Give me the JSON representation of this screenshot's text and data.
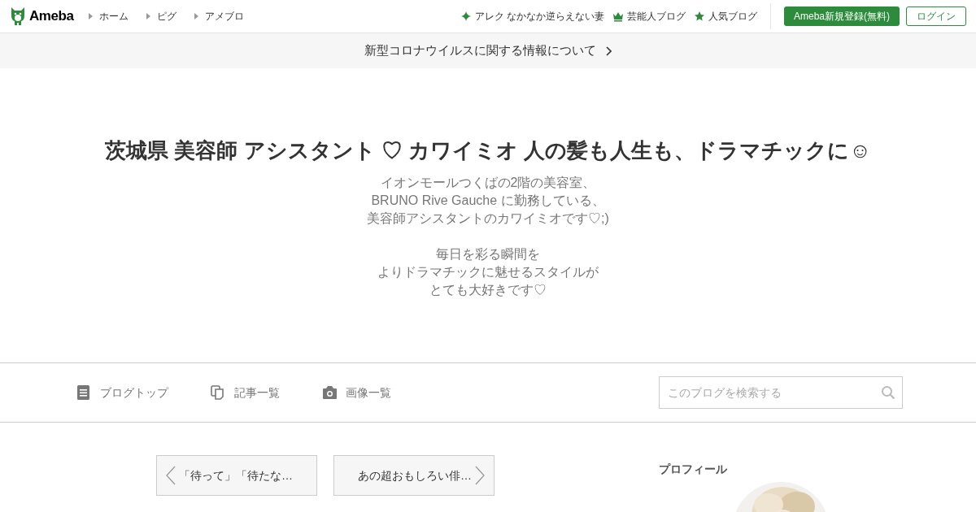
{
  "header": {
    "logo": "Ameba",
    "nav": [
      {
        "label": "ホーム"
      },
      {
        "label": "ピグ"
      },
      {
        "label": "アメブロ"
      }
    ],
    "links": [
      {
        "kind": "sparkle",
        "label": "アレク なかなか逆らえない妻"
      },
      {
        "kind": "crown",
        "label": "芸能人ブログ"
      },
      {
        "kind": "star",
        "label": "人気ブログ"
      }
    ],
    "register_button": "Ameba新規登録(無料)",
    "login_button": "ログイン"
  },
  "notice": {
    "text": "新型コロナウイルスに関する情報について"
  },
  "blog": {
    "title": "茨城県 美容師 アシスタント ♡ カワイミオ 人の髪も人生も、ドラマチックに☺",
    "description": [
      [
        "イオンモールつくばの2階の美容室、",
        "BRUNO Rive Gauche に勤務している、",
        "美容師アシスタントのカワイミオです♡;)"
      ],
      [
        "毎日を彩る瞬間を",
        "よりドラマチックに魅せるスタイルが",
        "とても大好きです♡"
      ]
    ]
  },
  "blog_nav": {
    "items": [
      {
        "kind": "document",
        "label": "ブログトップ"
      },
      {
        "kind": "copy",
        "label": "記事一覧"
      },
      {
        "kind": "camera",
        "label": "画像一覧"
      }
    ],
    "search": {
      "placeholder": "このブログを検索する"
    }
  },
  "pager": {
    "previous": "「待って」「待たな…",
    "next": "あの超おもしろい俳…"
  },
  "sidebar": {
    "heading": "プロフィール"
  }
}
